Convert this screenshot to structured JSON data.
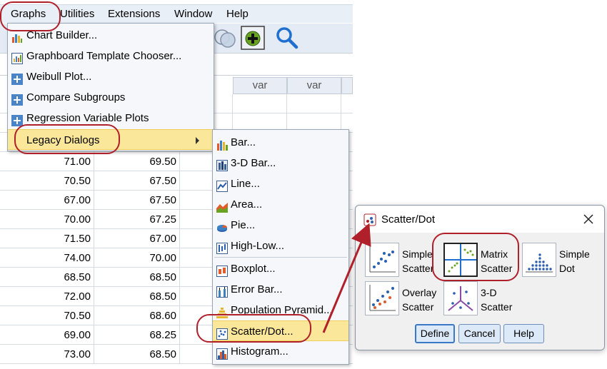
{
  "menubar": {
    "items": [
      "Graphs",
      "Utilities",
      "Extensions",
      "Window",
      "Help"
    ]
  },
  "grid": {
    "headers": [
      "var",
      "var"
    ],
    "rows": [
      [
        "71.00",
        "69.50"
      ],
      [
        "70.50",
        "67.50"
      ],
      [
        "67.00",
        "67.50"
      ],
      [
        "70.00",
        "67.25"
      ],
      [
        "71.50",
        "67.00"
      ],
      [
        "74.00",
        "70.00"
      ],
      [
        "68.50",
        "68.50"
      ],
      [
        "72.00",
        "68.50"
      ],
      [
        "70.50",
        "68.60"
      ],
      [
        "69.00",
        "68.25"
      ],
      [
        "73.00",
        "68.50"
      ]
    ]
  },
  "graphs_menu": {
    "items": [
      {
        "label": "Chart Builder...",
        "icon": "chart-builder-icon"
      },
      {
        "label": "Graphboard Template Chooser...",
        "icon": "graphboard-icon"
      },
      {
        "label": "Weibull Plot...",
        "icon": "plus-box-icon"
      },
      {
        "label": "Compare Subgroups",
        "icon": "plus-box-icon"
      },
      {
        "label": "Regression Variable Plots",
        "icon": "plus-box-icon"
      },
      {
        "label": "Legacy Dialogs",
        "icon": ""
      }
    ]
  },
  "legacy_menu": {
    "items": [
      {
        "label": "Bar...",
        "icon": "bar-chart-icon"
      },
      {
        "label": "3-D Bar...",
        "icon": "3d-bar-icon"
      },
      {
        "label": "Line...",
        "icon": "line-chart-icon"
      },
      {
        "label": "Area...",
        "icon": "area-chart-icon"
      },
      {
        "label": "Pie...",
        "icon": "pie-chart-icon"
      },
      {
        "label": "High-Low...",
        "icon": "high-low-icon"
      },
      {
        "label": "Boxplot...",
        "icon": "boxplot-icon"
      },
      {
        "label": "Error Bar...",
        "icon": "error-bar-icon"
      },
      {
        "label": "Population Pyramid...",
        "icon": "pyramid-icon"
      },
      {
        "label": "Scatter/Dot...",
        "icon": "scatter-icon"
      },
      {
        "label": "Histogram...",
        "icon": "histogram-icon"
      }
    ]
  },
  "dialog": {
    "title": "Scatter/Dot",
    "options": [
      {
        "line1": "Simple",
        "line2": "Scatter"
      },
      {
        "line1": "Matrix",
        "line2": "Scatter"
      },
      {
        "line1": "Simple",
        "line2": "Dot"
      },
      {
        "line1": "Overlay",
        "line2": "Scatter"
      },
      {
        "line1": "3-D",
        "line2": "Scatter"
      }
    ],
    "buttons": {
      "define": "Define",
      "cancel": "Cancel",
      "help": "Help"
    }
  },
  "colors": {
    "menubar_bg": "#e9eff7",
    "highlight": "#fbe79a",
    "annotation": "#b0202a",
    "button_bg": "#dbe9f8"
  }
}
